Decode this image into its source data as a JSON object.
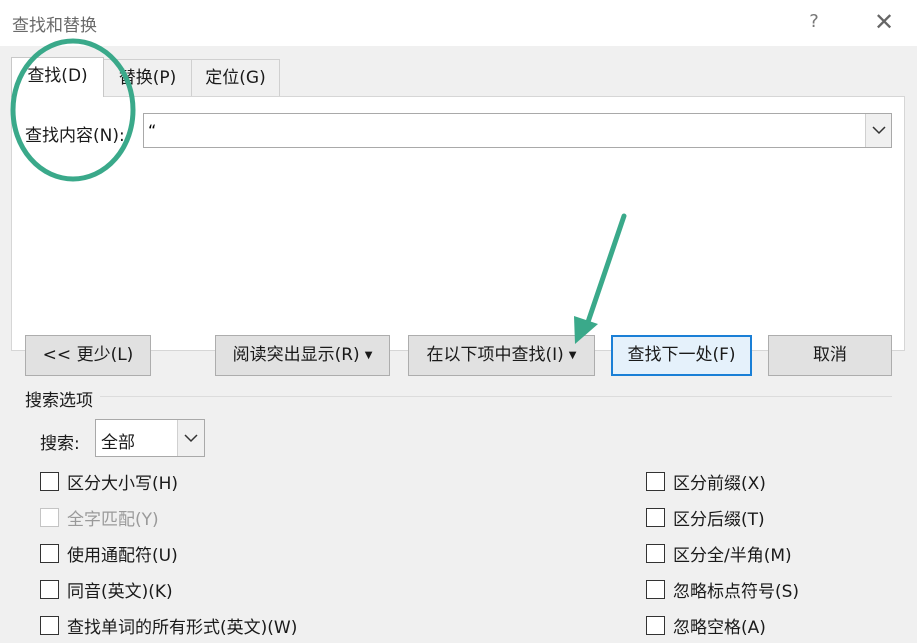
{
  "window": {
    "title": "查找和替换",
    "help": "?",
    "close": "✕"
  },
  "tabs": [
    {
      "label": "查找(D)"
    },
    {
      "label": "替换(P)"
    },
    {
      "label": "定位(G)"
    }
  ],
  "find": {
    "label": "查找内容(N):",
    "value": "“",
    "dropdown_icon": "chevron-down-icon"
  },
  "buttons": {
    "less": "<< 更少(L)",
    "reading_highlight": "阅读突出显示(R)",
    "find_in": "在以下项中查找(I)",
    "find_next": "查找下一处(F)",
    "cancel": "取消"
  },
  "search_options": {
    "section_label": "搜索选项",
    "search_label": "搜索:",
    "search_value": "全部",
    "left": [
      {
        "label": "区分大小写(H)",
        "enabled": true,
        "checked": false
      },
      {
        "label": "全字匹配(Y)",
        "enabled": false,
        "checked": false
      },
      {
        "label": "使用通配符(U)",
        "enabled": true,
        "checked": false
      },
      {
        "label": "同音(英文)(K)",
        "enabled": true,
        "checked": false
      },
      {
        "label": "查找单词的所有形式(英文)(W)",
        "enabled": true,
        "checked": false
      }
    ],
    "right": [
      {
        "label": "区分前缀(X)",
        "enabled": true,
        "checked": false
      },
      {
        "label": "区分后缀(T)",
        "enabled": true,
        "checked": false
      },
      {
        "label": "区分全/半角(M)",
        "enabled": true,
        "checked": false
      },
      {
        "label": "忽略标点符号(S)",
        "enabled": true,
        "checked": false
      },
      {
        "label": "忽略空格(A)",
        "enabled": true,
        "checked": false
      }
    ]
  },
  "colors": {
    "annotation": "#3aa98a",
    "primary_border": "#1a7fd6",
    "dialog_bg": "#f0f0f0"
  }
}
